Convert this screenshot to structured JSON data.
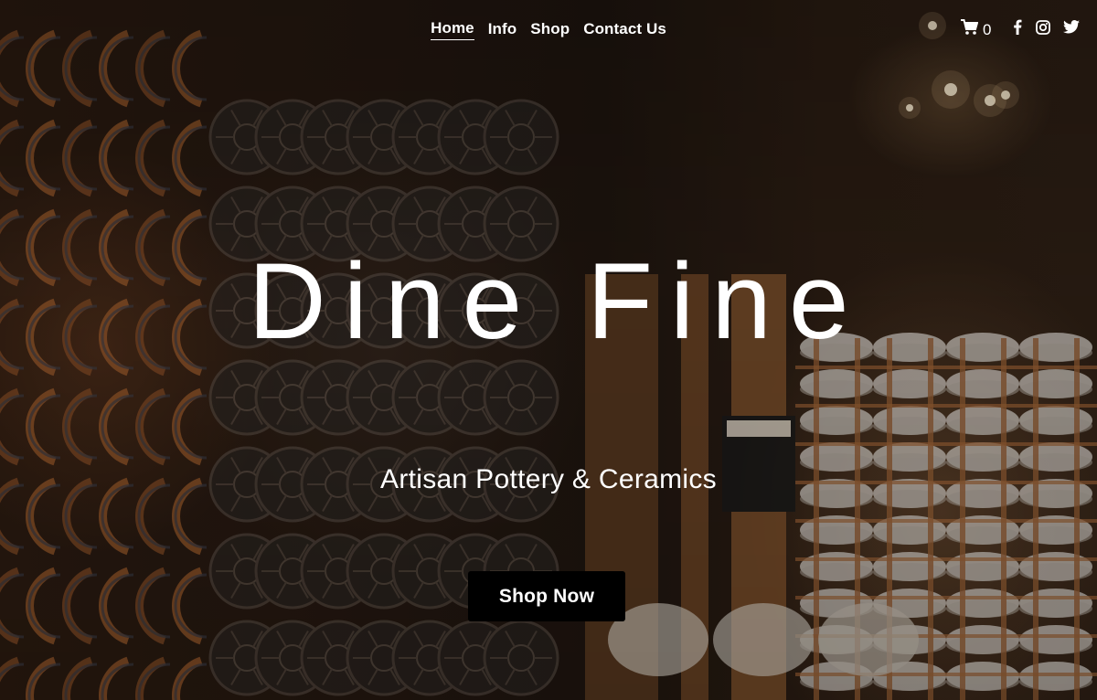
{
  "nav": {
    "items": [
      {
        "label": "Home"
      },
      {
        "label": "Info"
      },
      {
        "label": "Shop"
      },
      {
        "label": "Contact Us"
      }
    ]
  },
  "cart": {
    "count": "0",
    "icon": "cart-icon"
  },
  "social": [
    {
      "icon": "facebook-icon"
    },
    {
      "icon": "instagram-icon"
    },
    {
      "icon": "twitter-icon"
    }
  ],
  "hero": {
    "title": "Dine Fine",
    "subtitle": "Artisan Pottery & Ceramics",
    "cta_label": "Shop Now"
  },
  "colors": {
    "text": "#ffffff",
    "button_bg": "#000000",
    "background_dark": "#1a120c",
    "accent_clay": "#b06a3a"
  }
}
